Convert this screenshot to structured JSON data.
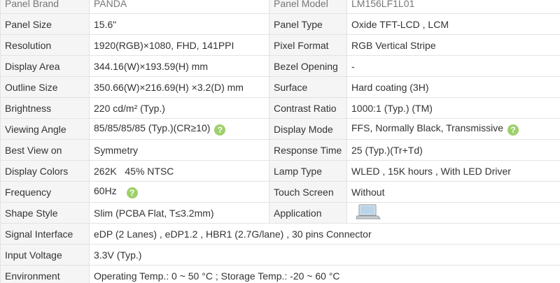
{
  "rows": [
    {
      "l1": "Panel Brand",
      "v1": "PANDA",
      "l2": "Panel Model",
      "v2": "LM156LF1L01"
    },
    {
      "l1": "Panel Size",
      "v1": "15.6\"",
      "l2": "Panel Type",
      "v2": "Oxide TFT-LCD , LCM"
    },
    {
      "l1": "Resolution",
      "v1": "1920(RGB)×1080, FHD, 141PPI",
      "l2": "Pixel Format",
      "v2": "RGB Vertical Stripe"
    },
    {
      "l1": "Display Area",
      "v1": "344.16(W)×193.59(H) mm",
      "l2": "Bezel Opening",
      "v2": "-"
    },
    {
      "l1": "Outline Size",
      "v1": "350.66(W)×216.69(H) ×3.2(D) mm",
      "l2": "Surface",
      "v2": "Hard coating (3H)"
    },
    {
      "l1": "Brightness",
      "v1": "220 cd/m² (Typ.)",
      "l2": "Contrast Ratio",
      "v2": "1000:1 (Typ.) (TM)"
    },
    {
      "l1": "Viewing Angle",
      "v1": "85/85/85/85 (Typ.)(CR≥10)",
      "l2": "Display Mode",
      "v2": "FFS, Normally Black, Transmissive"
    },
    {
      "l1": "Best View on",
      "v1": "Symmetry",
      "l2": "Response Time",
      "v2": "25 (Typ.)(Tr+Td)"
    },
    {
      "l1": "Display Colors",
      "v1": "262K   45% NTSC",
      "l2": "Lamp Type",
      "v2": "WLED , 15K hours , With LED Driver"
    },
    {
      "l1": "Frequency",
      "v1": "60Hz",
      "l2": "Touch Screen",
      "v2": "Without"
    },
    {
      "l1": "Shape Style",
      "v1": "Slim (PCBA Flat, T≤3.2mm)",
      "l2": "Application",
      "v2": ""
    }
  ],
  "wide_rows": [
    {
      "l": "Signal Interface",
      "v": "eDP (2 Lanes) , eDP1.2 , HBR1 (2.7G/lane) , 30 pins Connector"
    },
    {
      "l": "Input Voltage",
      "v": "3.3V (Typ.)"
    },
    {
      "l": "Environment",
      "v": "Operating Temp.: 0 ~ 50 °C ; Storage Temp.: -20 ~ 60 °C"
    }
  ],
  "help_icon_glyph": "?",
  "colors": {
    "label_bg": "#f5f5f5",
    "border": "#e3e3e3",
    "help_icon": "#9ed06c"
  },
  "application_icon": "laptop-icon"
}
